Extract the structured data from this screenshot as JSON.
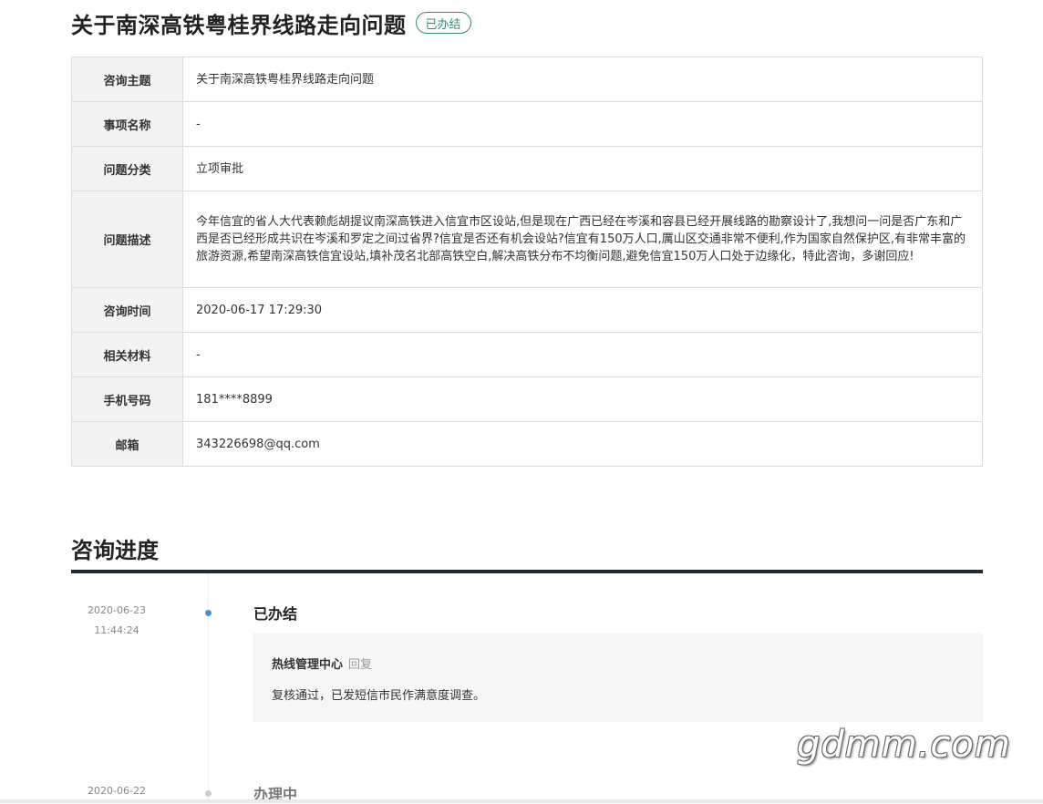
{
  "header": {
    "title": "关于南深高铁粤桂界线路走向问题",
    "status": "已办结"
  },
  "details": [
    {
      "label": "咨询主题",
      "value": "关于南深高铁粤桂界线路走向问题"
    },
    {
      "label": "事项名称",
      "value": "-"
    },
    {
      "label": "问题分类",
      "value": "立项审批"
    },
    {
      "label": "问题描述",
      "value": "今年信宜的省人大代表赖彪胡提议南深高铁进入信宜市区设站,但是现在广西已经在岑溪和容县已经开展线路的勘察设计了,我想问一问是否广东和广西是否已经形成共识在岑溪和罗定之间过省界?信宜是否还有机会设站?信宜有150万人口,厲山区交通非常不便利,作为国家自然保护区,有非常丰富的旅游资源,希望南深高铁信宜设站,填补茂名北部高铁空白,解决高铁分布不均衡问题,避免信宜150万人口处于边缘化，特此咨询，多谢回应!"
    },
    {
      "label": "咨询时间",
      "value": "2020-06-17 17:29:30"
    },
    {
      "label": "相关材料",
      "value": "-"
    },
    {
      "label": "手机号码",
      "value": "181****8899"
    },
    {
      "label": "邮箱",
      "value": "343226698@qq.com"
    }
  ],
  "progress": {
    "title": "咨询进度",
    "entries": [
      {
        "date": "2020-06-23",
        "time": "11:44:24",
        "status": "已办结",
        "reply_org": "热线管理中心",
        "reply_tag": "回复",
        "reply_text": "复核通过，已发短信市民作满意度调查。"
      },
      {
        "date": "2020-06-22",
        "status": "办理中"
      }
    ]
  },
  "watermark": "gdmm.com",
  "colors": {
    "accent_green": "#2f8f73",
    "timeline_dot_active": "#4a90d9",
    "rule_dark": "#1f2a33"
  }
}
